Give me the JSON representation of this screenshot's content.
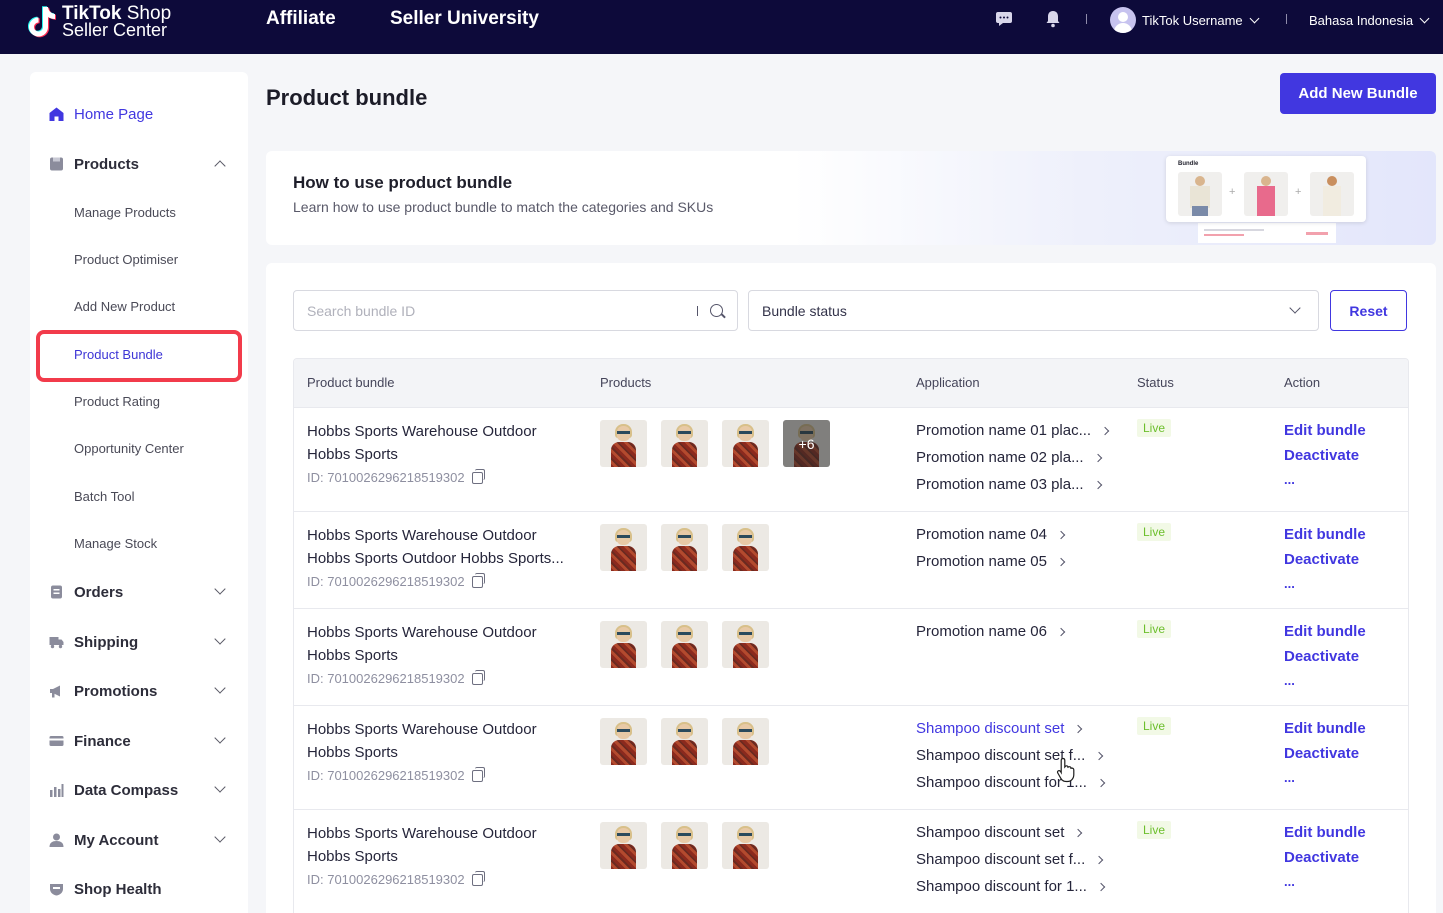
{
  "topbar": {
    "logo_line1_bold": "TikTok",
    "logo_line1_light": " Shop",
    "logo_line2": "Seller Center",
    "nav": [
      "Affiliate",
      "Seller University"
    ],
    "username": "TikTok Username",
    "language": "Bahasa Indonesia"
  },
  "sidebar": {
    "home": "Home Page",
    "products": "Products",
    "product_subitems": [
      "Manage Products",
      "Product Optimiser",
      "Add New Product",
      "Product Bundle",
      "Product Rating",
      "Opportunity Center",
      "Batch Tool",
      "Manage Stock"
    ],
    "sections": [
      "Orders",
      "Shipping",
      "Promotions",
      "Finance",
      "Data Compass",
      "My Account",
      "Shop Health"
    ]
  },
  "page": {
    "title": "Product bundle",
    "add_button": "Add New Bundle"
  },
  "banner": {
    "title": "How to use product bundle",
    "subtitle": "Learn how to use product bundle to match the categories and SKUs",
    "card_label": "Bundle"
  },
  "filters": {
    "search_placeholder": "Search bundle ID",
    "status_placeholder": "Bundle status",
    "reset": "Reset"
  },
  "table": {
    "headers": [
      "Product bundle",
      "Products",
      "Application",
      "Status",
      "Action"
    ],
    "rows": [
      {
        "name": "Hobbs Sports Warehouse Outdoor Hobbs Sports",
        "id": "ID: 7010026296218519302",
        "more_count": "+6",
        "applications": [
          "Promotion name 01 plac...",
          "Promotion name 02 pla...",
          "Promotion name 03 pla..."
        ],
        "status": "Live",
        "edit": "Edit bundle",
        "deactivate": "Deactivate",
        "more": "..."
      },
      {
        "name": "Hobbs Sports Warehouse Outdoor Hobbs Sports Outdoor Hobbs Sports...",
        "id": "ID: 7010026296218519302",
        "applications": [
          "Promotion name 04",
          "Promotion name 05"
        ],
        "status": "Live",
        "edit": "Edit bundle",
        "deactivate": "Deactivate",
        "more": "..."
      },
      {
        "name": "Hobbs Sports Warehouse Outdoor Hobbs Sports",
        "id": "ID: 7010026296218519302",
        "applications": [
          "Promotion name 06"
        ],
        "status": "Live",
        "edit": "Edit bundle",
        "deactivate": "Deactivate",
        "more": "..."
      },
      {
        "name": "Hobbs Sports Warehouse Outdoor Hobbs Sports",
        "id": "ID: 7010026296218519302",
        "applications": [
          "Shampoo discount set",
          "Shampoo discount set f...",
          "Shampoo discount for 1..."
        ],
        "status": "Live",
        "edit": "Edit bundle",
        "deactivate": "Deactivate",
        "more": "..."
      },
      {
        "name": "Hobbs Sports Warehouse Outdoor Hobbs Sports",
        "id": "ID: 7010026296218519302",
        "applications": [
          "Shampoo discount set",
          "Shampoo discount set f...",
          "Shampoo discount for 1..."
        ],
        "status": "Live",
        "edit": "Edit bundle",
        "deactivate": "Deactivate",
        "more": "..."
      }
    ]
  },
  "colors": {
    "topbar": "#0d0a3a",
    "accent": "#4137e0",
    "highlight": "#f23b4b",
    "live": "#6cbf2c"
  }
}
